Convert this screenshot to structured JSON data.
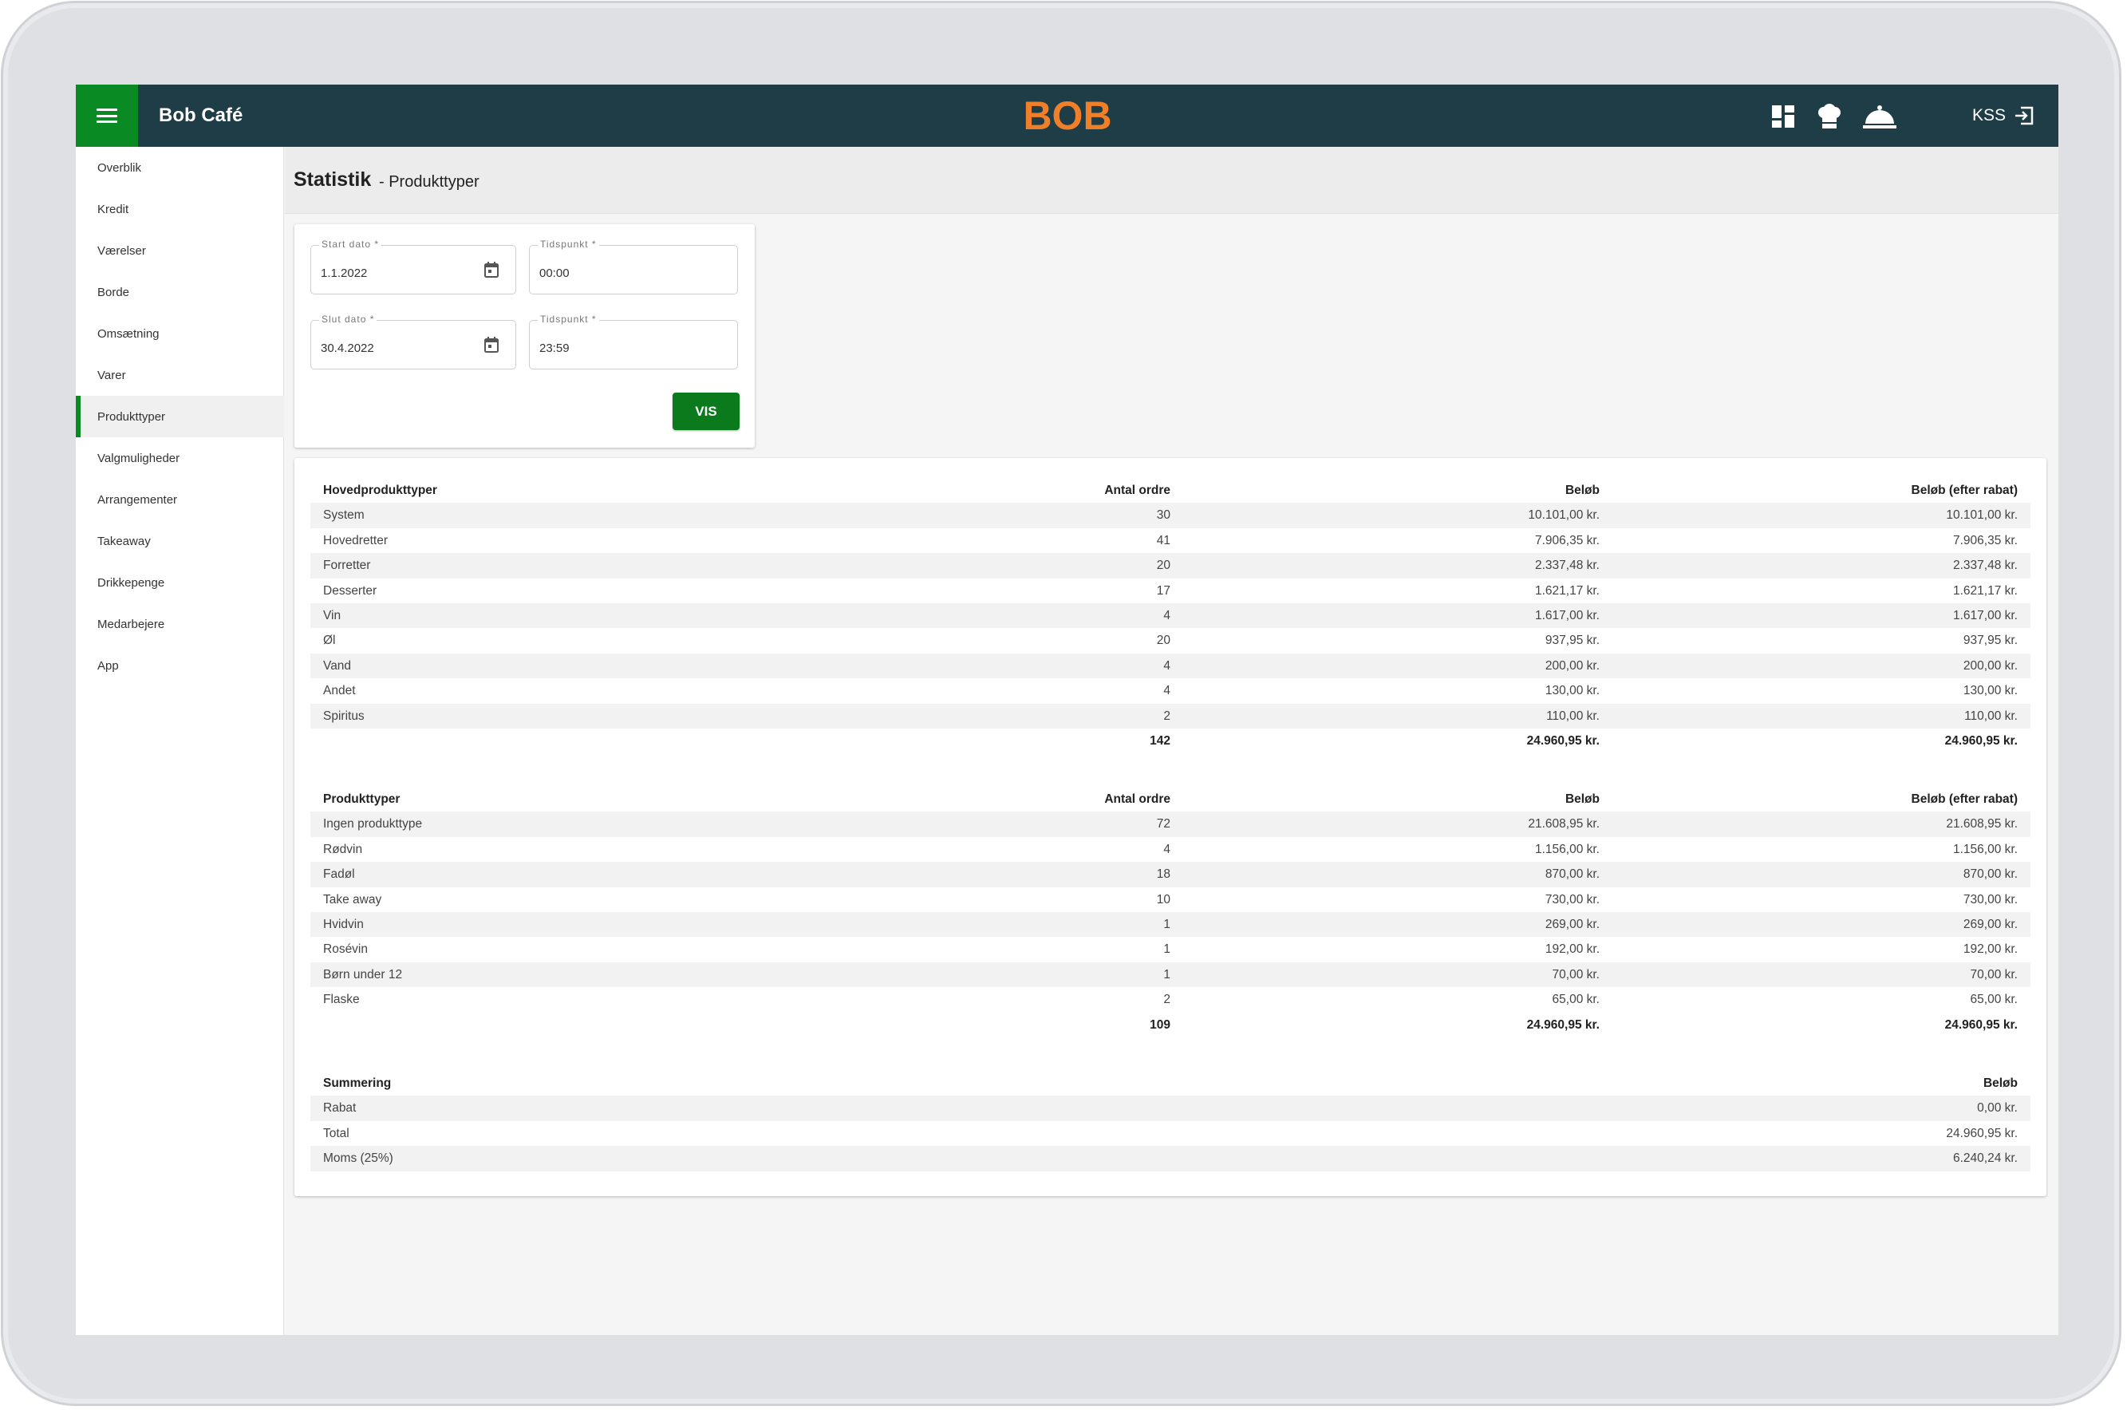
{
  "app": {
    "title": "Bob Café",
    "logo_text": "BOB",
    "user": "KSS",
    "icons": [
      "dashboard-icon",
      "chef-hat-icon",
      "cloche-icon",
      "logout-icon"
    ],
    "colors": {
      "topbar": "#1e3d46",
      "accent_green": "#0a8a22",
      "logo_orange": "#f07f2a"
    }
  },
  "sidebar": {
    "items": [
      {
        "label": "Overblik"
      },
      {
        "label": "Kredit"
      },
      {
        "label": "Værelser"
      },
      {
        "label": "Borde"
      },
      {
        "label": "Omsætning"
      },
      {
        "label": "Varer"
      },
      {
        "label": "Produkttyper",
        "active": true
      },
      {
        "label": "Valgmuligheder"
      },
      {
        "label": "Arrangementer"
      },
      {
        "label": "Takeaway"
      },
      {
        "label": "Drikkepenge"
      },
      {
        "label": "Medarbejere"
      },
      {
        "label": "App"
      }
    ]
  },
  "header": {
    "title": "Statistik",
    "subtitle": "- Produkttyper"
  },
  "filters": {
    "start_date": {
      "label": "Start dato *",
      "value": "1.1.2022"
    },
    "start_time": {
      "label": "Tidspunkt *",
      "value": "00:00"
    },
    "end_date": {
      "label": "Slut dato *",
      "value": "30.4.2022"
    },
    "end_time": {
      "label": "Tidspunkt *",
      "value": "23:59"
    },
    "submit_label": "VIS"
  },
  "main_types": {
    "headers": [
      "Hovedprodukttyper",
      "Antal ordre",
      "Beløb",
      "Beløb (efter rabat)"
    ],
    "rows": [
      [
        "System",
        "30",
        "10.101,00 kr.",
        "10.101,00 kr."
      ],
      [
        "Hovedretter",
        "41",
        "7.906,35 kr.",
        "7.906,35 kr."
      ],
      [
        "Forretter",
        "20",
        "2.337,48 kr.",
        "2.337,48 kr."
      ],
      [
        "Desserter",
        "17",
        "1.621,17 kr.",
        "1.621,17 kr."
      ],
      [
        "Vin",
        "4",
        "1.617,00 kr.",
        "1.617,00 kr."
      ],
      [
        "Øl",
        "20",
        "937,95 kr.",
        "937,95 kr."
      ],
      [
        "Vand",
        "4",
        "200,00 kr.",
        "200,00 kr."
      ],
      [
        "Andet",
        "4",
        "130,00 kr.",
        "130,00 kr."
      ],
      [
        "Spiritus",
        "2",
        "110,00 kr.",
        "110,00 kr."
      ]
    ],
    "total": [
      "",
      "142",
      "24.960,95 kr.",
      "24.960,95 kr."
    ]
  },
  "product_types": {
    "headers": [
      "Produkttyper",
      "Antal ordre",
      "Beløb",
      "Beløb (efter rabat)"
    ],
    "rows": [
      [
        "Ingen produkttype",
        "72",
        "21.608,95 kr.",
        "21.608,95 kr."
      ],
      [
        "Rødvin",
        "4",
        "1.156,00 kr.",
        "1.156,00 kr."
      ],
      [
        "Fadøl",
        "18",
        "870,00 kr.",
        "870,00 kr."
      ],
      [
        "Take away",
        "10",
        "730,00 kr.",
        "730,00 kr."
      ],
      [
        "Hvidvin",
        "1",
        "269,00 kr.",
        "269,00 kr."
      ],
      [
        "Rosévin",
        "1",
        "192,00 kr.",
        "192,00 kr."
      ],
      [
        "Børn under 12",
        "1",
        "70,00 kr.",
        "70,00 kr."
      ],
      [
        "Flaske",
        "2",
        "65,00 kr.",
        "65,00 kr."
      ]
    ],
    "total": [
      "",
      "109",
      "24.960,95 kr.",
      "24.960,95 kr."
    ]
  },
  "summary": {
    "headers": [
      "Summering",
      "",
      "",
      "Beløb"
    ],
    "rows": [
      [
        "Rabat",
        "",
        "",
        "0,00 kr."
      ],
      [
        "Total",
        "",
        "",
        "24.960,95 kr."
      ],
      [
        "Moms (25%)",
        "",
        "",
        "6.240,24 kr."
      ]
    ]
  }
}
